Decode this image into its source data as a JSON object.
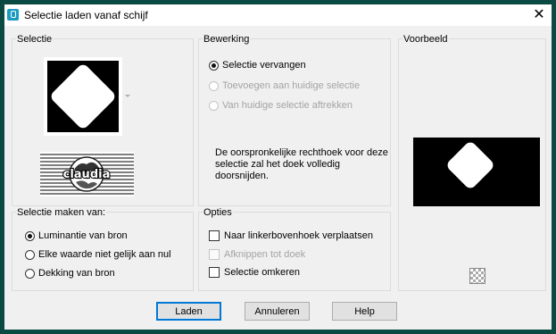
{
  "window": {
    "title": "Selectie laden vanaf schijf",
    "close_glyph": "✕"
  },
  "selectie_group": {
    "label": "Selectie"
  },
  "bewerking": {
    "label": "Bewerking",
    "options": [
      {
        "label": "Selectie vervangen",
        "checked": true,
        "enabled": true
      },
      {
        "label": "Toevoegen aan huidige selectie",
        "checked": false,
        "enabled": false
      },
      {
        "label": "Van huidige selectie aftrekken",
        "checked": false,
        "enabled": false
      }
    ],
    "description": "De oorspronkelijke rechthoek voor deze selectie zal het doek volledig doorsnijden."
  },
  "voorbeeld": {
    "label": "Voorbeeld"
  },
  "maken_van": {
    "label": "Selectie maken van:",
    "options": [
      {
        "label": "Luminantie van bron",
        "checked": true
      },
      {
        "label": "Elke waarde niet gelijk aan nul",
        "checked": false
      },
      {
        "label": "Dekking van bron",
        "checked": false
      }
    ]
  },
  "opties": {
    "label": "Opties",
    "items": [
      {
        "label": "Naar linkerbovenhoek verplaatsen",
        "checked": false,
        "enabled": true
      },
      {
        "label": "Afknippen tot doek",
        "checked": false,
        "enabled": false
      },
      {
        "label": "Selectie omkeren",
        "checked": false,
        "enabled": true
      }
    ]
  },
  "buttons": {
    "load": "Laden",
    "cancel": "Annuleren",
    "help": "Help"
  },
  "watermark": {
    "text": "claudia"
  },
  "colors": {
    "frame": "#0b4a43",
    "dialog_bg": "#f0f0f0",
    "default_button_border": "#0078d7"
  }
}
